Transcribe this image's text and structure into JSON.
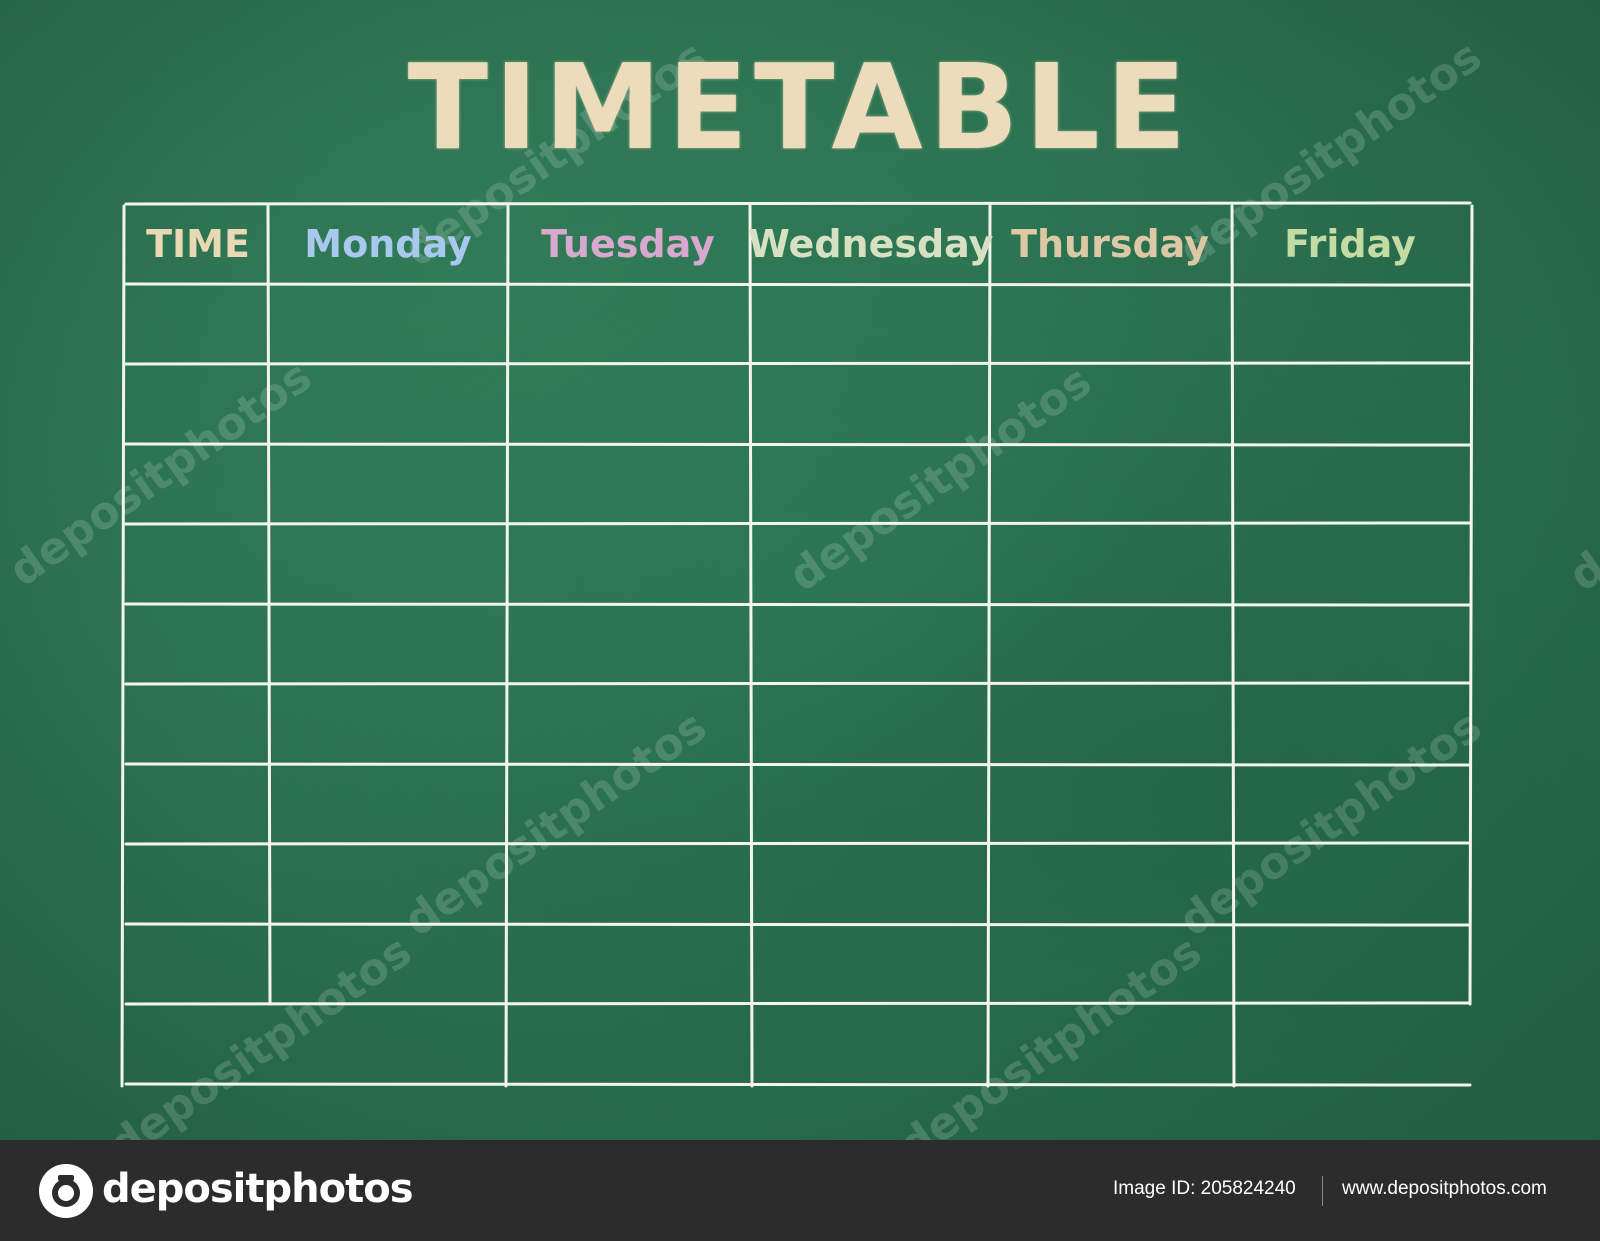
{
  "title": "TIMETABLE",
  "headers": [
    {
      "label": "TIME",
      "color": "#e9d8b4"
    },
    {
      "label": "Monday",
      "color": "#a9c8ee"
    },
    {
      "label": "Tuesday",
      "color": "#d9a8cf"
    },
    {
      "label": "Wednesday",
      "color": "#d8e0c2"
    },
    {
      "label": "Thursday",
      "color": "#dcc8a4"
    },
    {
      "label": "Friday",
      "color": "#c4dca4"
    }
  ],
  "watermark_text": "depositphotos",
  "footer": {
    "brand": "depositphotos",
    "image_id": "Image ID: 205824240",
    "site": "www.depositphotos.com"
  },
  "colors": {
    "board": "#2a6f4f",
    "chalk": "#f4f4ee",
    "footer_bg": "#2c2c2c"
  }
}
